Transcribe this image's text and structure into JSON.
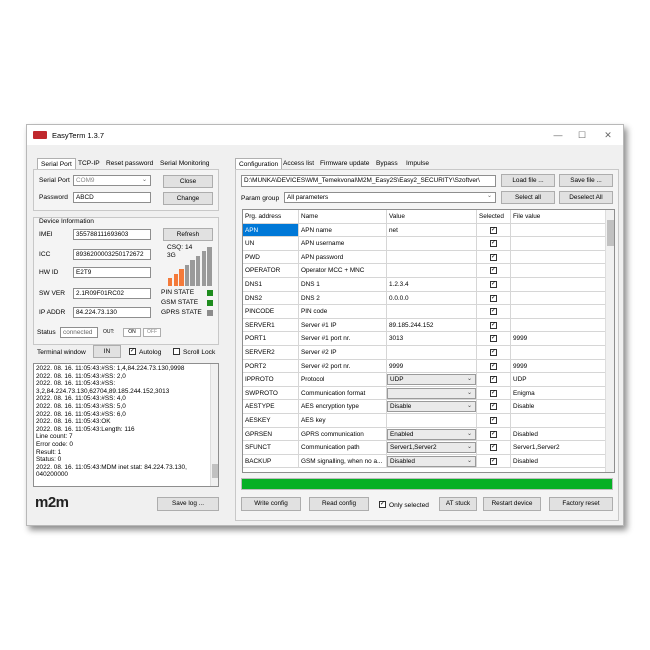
{
  "window": {
    "title": "EasyTerm 1.3.7"
  },
  "left": {
    "tabs": [
      "Serial Port",
      "TCP-IP",
      "Reset password",
      "Serial Monitoring"
    ],
    "serial_port_label": "Serial Port",
    "serial_port_value": "COM9",
    "close_btn": "Close",
    "password_label": "Password",
    "password_value": "ABCD",
    "change_btn": "Change",
    "device_info_label": "Device Information",
    "imei_label": "IMEI",
    "imei_value": "355788111693603",
    "refresh_btn": "Refresh",
    "icc_label": "ICC",
    "icc_value": "8936200003250172672",
    "csq_label": "CSQ: 14",
    "net_label": "3G",
    "hwid_label": "HW ID",
    "hwid_value": "E2T9",
    "swver_label": "SW VER",
    "swver_value": "2.1R09F01RC02",
    "ipaddr_label": "IP ADDR",
    "ipaddr_value": "84.224.73.130",
    "pin_state": "PIN STATE",
    "gsm_state": "GSM STATE",
    "gprs_state": "GPRS STATE",
    "status_label": "Status",
    "status_value": "connected",
    "out_label": "OUT:",
    "on_label": "ON",
    "off_label": "OFF",
    "terminal_label": "Terminal window",
    "in_btn": "IN",
    "autolog_label": "Autolog",
    "scrolllock_label": "Scroll Lock",
    "log_lines": [
      "2022. 08. 16. 11:05:43:#SS: 1,4,84.224.73.130,9998",
      "2022. 08. 16. 11:05:43:#SS: 2,0",
      "2022. 08. 16. 11:05:43:#SS:",
      "3,2,84.224.73.130,62704,89.185.244.152,3013",
      "2022. 08. 16. 11:05:43:#SS: 4,0",
      "2022. 08. 16. 11:05:43:#SS: 5,0",
      "2022. 08. 16. 11:05:43:#SS: 6,0",
      "2022. 08. 16. 11:05:43:OK",
      "2022. 08. 16. 11:05:43:Length: 116",
      "Line count: 7",
      "Error code: 0",
      "Result: 1",
      "Status: 0",
      "2022. 08. 16. 11:05:43:MDM inet stat: 84.224.73.130,",
      "040200000"
    ],
    "logo": "m2m",
    "savelog_btn": "Save log ..."
  },
  "right": {
    "tabs": [
      "Configuration",
      "Access list",
      "Firmware update",
      "Bypass",
      "Impulse"
    ],
    "path_value": "D:\\MUNKA\\DEVICES\\WM_Temekvonal\\M2M_Easy2S\\Easy2_SECURITY\\Szoftver\\",
    "loadfile_btn": "Load file ...",
    "savefile_btn": "Save file ...",
    "paramgroup_label": "Param group",
    "paramgroup_value": "All parameters",
    "selectall_btn": "Select all",
    "deselectall_btn": "Deselect All",
    "columns": [
      "Prg. address",
      "Name",
      "Value",
      "Selected",
      "File value"
    ],
    "rows": [
      {
        "addr": "APN",
        "name": "APN name",
        "value": "net",
        "file": "",
        "dd": false,
        "selected": true
      },
      {
        "addr": "UN",
        "name": "APN username",
        "value": "",
        "file": "",
        "dd": false
      },
      {
        "addr": "PWD",
        "name": "APN password",
        "value": "",
        "file": "",
        "dd": false
      },
      {
        "addr": "OPERATOR",
        "name": "Operator MCC + MNC",
        "value": "",
        "file": "",
        "dd": false
      },
      {
        "addr": "DNS1",
        "name": "DNS 1",
        "value": "1.2.3.4",
        "file": "",
        "dd": false
      },
      {
        "addr": "DNS2",
        "name": "DNS 2",
        "value": "0.0.0.0",
        "file": "",
        "dd": false
      },
      {
        "addr": "PINCODE",
        "name": "PIN code",
        "value": "",
        "file": "",
        "dd": false
      },
      {
        "addr": "SERVER1",
        "name": "Server #1 IP",
        "value": "89.185.244.152",
        "file": "",
        "dd": false
      },
      {
        "addr": "PORT1",
        "name": "Server #1 port nr.",
        "value": "3013",
        "file": "9999",
        "dd": false
      },
      {
        "addr": "SERVER2",
        "name": "Server #2 IP",
        "value": "",
        "file": "",
        "dd": false
      },
      {
        "addr": "PORT2",
        "name": "Server #2 port nr.",
        "value": "9999",
        "file": "9999",
        "dd": false
      },
      {
        "addr": "IPPROTO",
        "name": "Protocol",
        "value": "UDP",
        "file": "UDP",
        "dd": true
      },
      {
        "addr": "SWPROTO",
        "name": "Communication format",
        "value": "",
        "file": "Enigma",
        "dd": true
      },
      {
        "addr": "AESTYPE",
        "name": "AES encryption type",
        "value": "Disable",
        "file": "Disable",
        "dd": true
      },
      {
        "addr": "AESKEY",
        "name": "AES key",
        "value": "",
        "file": "",
        "dd": false
      },
      {
        "addr": "GPRSEN",
        "name": "GPRS communication",
        "value": "Enabled",
        "file": "Disabled",
        "dd": true
      },
      {
        "addr": "SFUNCT",
        "name": "Communication path",
        "value": "Server1,Server2",
        "file": "Server1,Server2",
        "dd": true
      },
      {
        "addr": "BACKUP",
        "name": "GSM signalling, when no a...",
        "value": "Disabled",
        "file": "Disabled",
        "dd": true
      }
    ],
    "progress": 1.0,
    "writeconfig_btn": "Write config",
    "readconfig_btn": "Read config",
    "onlyselected_label": "Only selected",
    "atstuck_btn": "AT stuck",
    "restart_btn": "Restart device",
    "factoryreset_btn": "Factory reset"
  },
  "colors": {
    "selection": "#0078d7",
    "progress": "#06b025",
    "led_green": "#1e8c1e",
    "led_gray": "#8c8c8c",
    "logo_red": "#c0282d"
  }
}
